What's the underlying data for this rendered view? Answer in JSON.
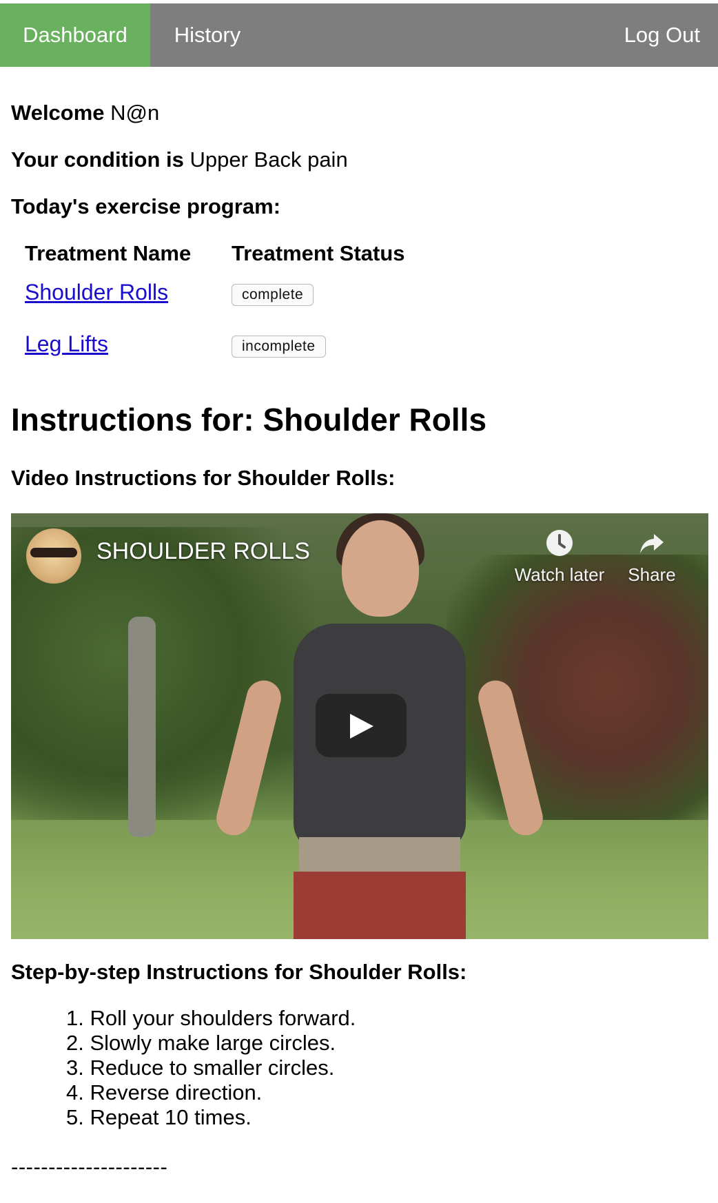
{
  "nav": {
    "dashboard": "Dashboard",
    "history": "History",
    "logout": "Log Out",
    "active_color": "#6ab15f",
    "bar_color": "#7e7e7e"
  },
  "user": {
    "welcome_label": "Welcome",
    "name": "N@n",
    "condition_label": "Your condition is",
    "condition": "Upper Back pain"
  },
  "program": {
    "heading": "Today's exercise program:",
    "col_name": "Treatment Name",
    "col_status": "Treatment Status",
    "rows": [
      {
        "name": "Shoulder Rolls",
        "status": "complete"
      },
      {
        "name": "Leg Lifts",
        "status": "incomplete"
      }
    ]
  },
  "instructions": {
    "title": "Instructions for: Shoulder Rolls",
    "video_heading": "Video Instructions for Shoulder Rolls:",
    "video": {
      "title": "SHOULDER ROLLS",
      "watch_later": "Watch later",
      "share": "Share",
      "icons": {
        "watch_later": "clock-icon",
        "share": "share-arrow-icon",
        "play": "play-icon",
        "channel": "channel-avatar"
      }
    },
    "steps_heading": "Step-by-step Instructions for Shoulder Rolls:",
    "steps": [
      "1. Roll your shoulders forward.",
      "2. Slowly make large circles.",
      "3. Reduce to smaller circles.",
      "4. Reverse direction.",
      "5. Repeat 10 times."
    ],
    "divider": "---------------------"
  }
}
